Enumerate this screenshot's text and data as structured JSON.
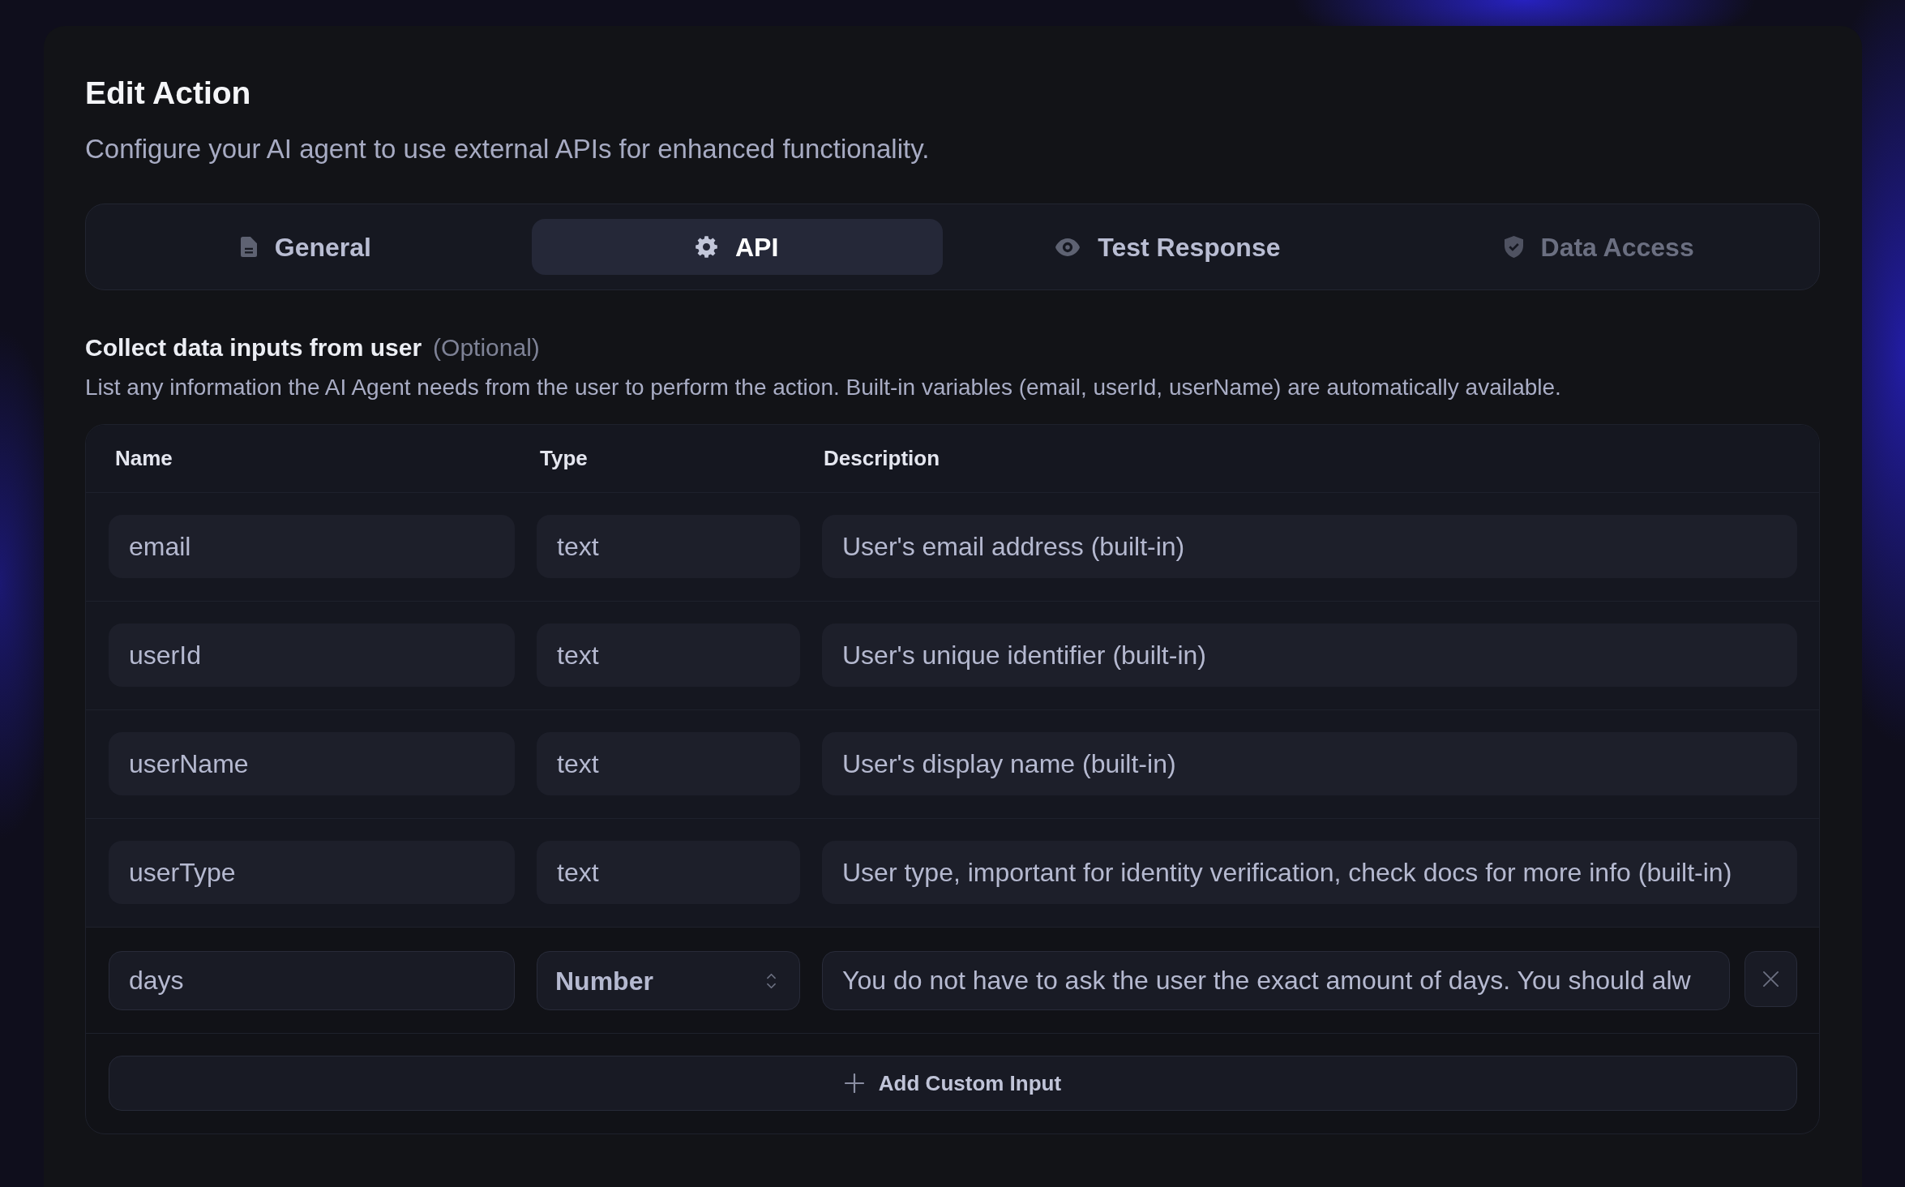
{
  "dialog": {
    "title": "Edit Action",
    "subtitle": "Configure your AI agent to use external APIs for enhanced functionality."
  },
  "tabs": [
    {
      "label": "General",
      "selected": false,
      "disabled": false
    },
    {
      "label": "API",
      "selected": true,
      "disabled": false
    },
    {
      "label": "Test Response",
      "selected": false,
      "disabled": false
    },
    {
      "label": "Data Access",
      "selected": false,
      "disabled": true
    }
  ],
  "inputs_section": {
    "title": "Collect data inputs from user",
    "note": "(Optional)",
    "description": "List any information the AI Agent needs from the user to perform the action. Built-in variables (email, userId, userName) are automatically available.",
    "columns": [
      "Name",
      "Type",
      "Description"
    ],
    "rows": [
      {
        "name": "email",
        "type": "text",
        "description": "User's email address (built-in)",
        "readonly": true
      },
      {
        "name": "userId",
        "type": "text",
        "description": "User's unique identifier (built-in)",
        "readonly": true
      },
      {
        "name": "userName",
        "type": "text",
        "description": "User's display name (built-in)",
        "readonly": true
      },
      {
        "name": "userType",
        "type": "text",
        "description": "User type, important for identity verification, check docs for more info (built-in)",
        "readonly": true
      },
      {
        "name": "days",
        "type": "Number",
        "description": "You do not have to ask the user the exact amount of days. You should alw",
        "readonly": false
      }
    ],
    "add_button": {
      "label": "Add Custom Input"
    }
  }
}
